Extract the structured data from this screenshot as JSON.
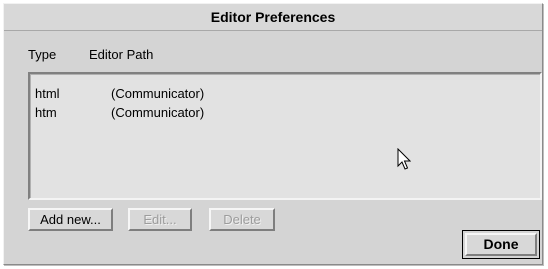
{
  "window": {
    "title": "Editor Preferences"
  },
  "columns": {
    "type": "Type",
    "path": "Editor Path"
  },
  "rows": [
    {
      "type": "html",
      "path": "(Communicator)"
    },
    {
      "type": "htm",
      "path": "(Communicator)"
    }
  ],
  "buttons": {
    "add_new": "Add new...",
    "edit": "Edit...",
    "delete": "Delete",
    "done": "Done"
  },
  "icons": {
    "cursor": "mouse-pointer-icon"
  },
  "colors": {
    "background": "#d4d4d4",
    "list_background": "#e2e2e2",
    "disabled_text": "#9c9c9c"
  }
}
